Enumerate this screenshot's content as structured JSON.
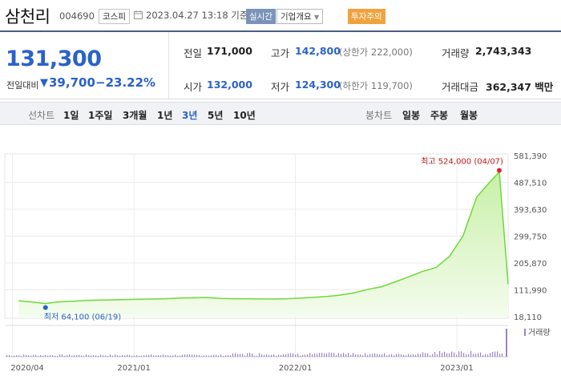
{
  "stock": {
    "name": "삼천리",
    "code": "004690",
    "market": "코스피",
    "timestamp": "2023.04.27 13:18 기준(장중)",
    "realtime_badge": "실시간",
    "company_info": "기업개요",
    "caution_badge": "투자주의"
  },
  "quote": {
    "price": "131,300",
    "change_label": "전일대비",
    "change_value": "39,700",
    "change_pct": "−23.22%",
    "prev_close_label": "전일",
    "prev_close": "171,000",
    "high_label": "고가",
    "high": "142,800",
    "upper_limit": "(상한가 222,000)",
    "volume_label": "거래량",
    "volume": "2,743,343",
    "open_label": "시가",
    "open": "132,000",
    "low_label": "저가",
    "low": "124,300",
    "lower_limit": "(하한가 119,700)",
    "amount_label": "거래대금",
    "amount": "362,347 백만"
  },
  "periods": {
    "line_label": "선차트",
    "line_tabs": [
      "1일",
      "1주일",
      "3개월",
      "1년",
      "3년",
      "5년",
      "10년"
    ],
    "selected": "3년",
    "candle_label": "봉차트",
    "candle_tabs": [
      "일봉",
      "주봉",
      "월봉"
    ]
  },
  "colors": {
    "price_down": "#2a62c9",
    "line": "#6ed83a",
    "area_top": "#c8f0a8",
    "high_marker": "#e8202a",
    "low_marker": "#2a62c9",
    "volume_bar": "#9a84cc"
  },
  "chart_data": {
    "type": "area",
    "y_ticks": [
      "581,390",
      "487,510",
      "393,630",
      "299,750",
      "205,870",
      "111,990",
      "18,110"
    ],
    "ylim": [
      18110,
      581390
    ],
    "x_ticks": [
      "2020/04",
      "2021/01",
      "2022/01",
      "2023/01"
    ],
    "high_annotation": "최고 524,000 (04/07)",
    "low_annotation": "최저 64,100 (06/19)",
    "volume_label": "거래량",
    "series": [
      {
        "x": [
          "2020/04",
          "2020/05",
          "2020/06",
          "2020/07",
          "2020/08",
          "2020/09",
          "2020/10",
          "2020/11",
          "2020/12",
          "2021/01",
          "2021/02",
          "2021/03",
          "2021/04",
          "2021/05",
          "2021/06",
          "2021/07",
          "2021/08",
          "2021/09",
          "2021/10",
          "2021/11",
          "2021/12",
          "2022/01",
          "2022/02",
          "2022/03",
          "2022/04",
          "2022/05",
          "2022/06",
          "2022/07",
          "2022/08",
          "2022/09",
          "2022/10",
          "2022/11",
          "2022/12",
          "2023/01",
          "2023/02",
          "2023/03",
          "2023/04/07",
          "2023/04/27"
        ],
        "values": [
          74000,
          69000,
          64100,
          70000,
          72000,
          75000,
          76000,
          77000,
          78000,
          79000,
          80000,
          81000,
          83000,
          84000,
          85000,
          82000,
          81000,
          81000,
          80000,
          80000,
          81000,
          83000,
          86000,
          89000,
          94000,
          102000,
          114000,
          123000,
          140000,
          158000,
          176000,
          190000,
          228000,
          300000,
          436000,
          486000,
          524000,
          131300
        ]
      }
    ]
  }
}
